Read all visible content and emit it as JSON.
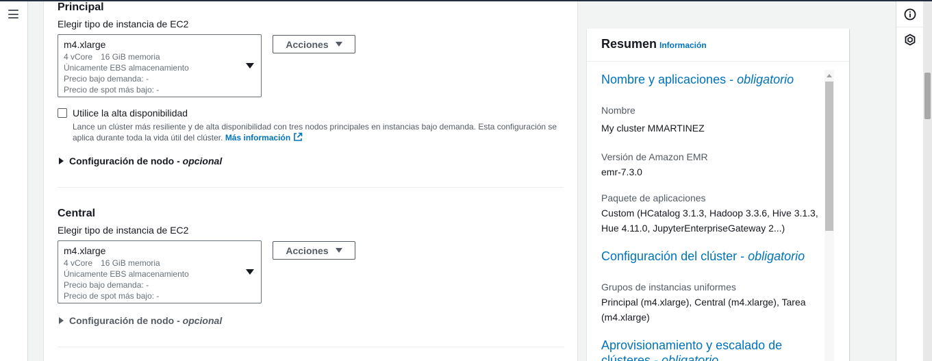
{
  "nav": {
    "menu_icon": "hamburger-menu-icon"
  },
  "principal": {
    "section_title": "Principal",
    "field_label": "Elegir tipo de instancia de EC2",
    "instance": {
      "name": "m4.xlarge",
      "vcore": "4 vCore",
      "memory": "16 GiB memoria",
      "storage": "Únicamente EBS almacenamiento",
      "on_demand_price": "Precio bajo demanda: -",
      "spot_price": "Precio de spot más bajo: -"
    },
    "actions_label": "Acciones",
    "high_availability": {
      "label": "Utilice la alta disponibilidad",
      "checked": false,
      "description": "Lance un clúster más resiliente y de alta disponibilidad con tres nodos principales en instancias bajo demanda. Esta configuración se aplica durante toda la vida útil del clúster.",
      "more_info": "Más información"
    },
    "node_config": {
      "label": "Configuración de nodo - ",
      "optional": "opcional"
    }
  },
  "central": {
    "section_title": "Central",
    "field_label": "Elegir tipo de instancia de EC2",
    "instance": {
      "name": "m4.xlarge",
      "vcore": "4 vCore",
      "memory": "16 GiB memoria",
      "storage": "Únicamente EBS almacenamiento",
      "on_demand_price": "Precio bajo demanda: -",
      "spot_price": "Precio de spot más bajo: -"
    },
    "actions_label": "Acciones",
    "node_config": {
      "label": "Configuración de nodo - ",
      "optional": "opcional"
    }
  },
  "summary": {
    "title": "Resumen",
    "info_link": "Información",
    "names_apps": {
      "link": "Nombre y aplicaciones - ",
      "required": "obligatorio"
    },
    "name_label": "Nombre",
    "name_value": "My cluster MMARTINEZ",
    "emr_label": "Versión de Amazon EMR",
    "emr_value": "emr-7.3.0",
    "apps_label": "Paquete de aplicaciones",
    "apps_value": "Custom (HCatalog 3.1.3, Hadoop 3.3.6, Hive 3.1.3, Hue 4.11.0, JupyterEnterpriseGateway 2...)",
    "cluster_config": {
      "link": "Configuración del clúster - ",
      "required": "obligatorio"
    },
    "groups_label": "Grupos de instancias uniformes",
    "groups_value": "Principal (m4.xlarge), Central (m4.xlarge), Tarea (m4.xlarge)",
    "provisioning": {
      "line1": "Aprovisionamiento y escalado de",
      "line2": "clústeres - ",
      "required": "obligatorio"
    }
  },
  "right_rail": {
    "icons": [
      "info-circle-icon",
      "hexagon-help-icon"
    ]
  },
  "colors": {
    "link": "#0073bb",
    "text": "#16191f",
    "muted": "#545b64",
    "border": "#687078"
  }
}
